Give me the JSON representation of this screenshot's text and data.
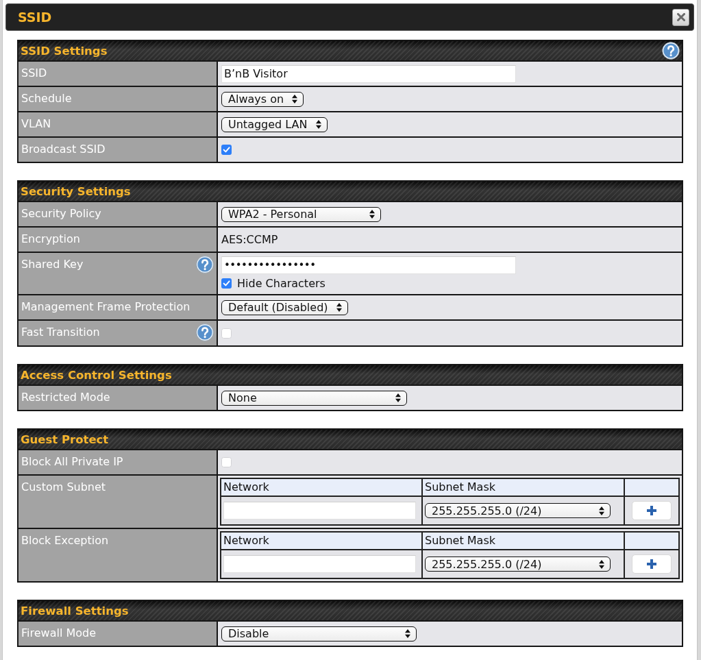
{
  "dialog": {
    "title": "SSID"
  },
  "sections": [
    {
      "title": "SSID Settings",
      "help": true,
      "rows": [
        {
          "kind": "text",
          "label": "SSID",
          "value": "B’nB Visitor"
        },
        {
          "kind": "select",
          "label": "Schedule",
          "value": "Always on"
        },
        {
          "kind": "select",
          "label": "VLAN",
          "value": "Untagged LAN"
        },
        {
          "kind": "checkbox",
          "label": "Broadcast SSID",
          "checked": true
        }
      ]
    },
    {
      "title": "Security Settings",
      "rows": [
        {
          "kind": "select",
          "label": "Security Policy",
          "value": "WPA2 - Personal"
        },
        {
          "kind": "static",
          "label": "Encryption",
          "value": "AES:CCMP"
        },
        {
          "kind": "password",
          "label": "Shared Key",
          "help": true,
          "value": "••••••••••••••••",
          "option": {
            "label": "Hide Characters",
            "checked": true
          }
        },
        {
          "kind": "select",
          "label": "Management Frame Protection",
          "value": "Default (Disabled)"
        },
        {
          "kind": "checkbox",
          "label": "Fast Transition",
          "help": true,
          "checked": false
        }
      ]
    },
    {
      "title": "Access Control Settings",
      "rows": [
        {
          "kind": "select",
          "label": "Restricted Mode",
          "value": "None"
        }
      ]
    },
    {
      "title": "Guest Protect",
      "rows": [
        {
          "kind": "checkbox",
          "label": "Block All Private IP",
          "checked": false
        },
        {
          "kind": "subnet",
          "label": "Custom Subnet",
          "columns": [
            "Network",
            "Subnet Mask"
          ],
          "mask": "255.255.255.0 (/24)"
        },
        {
          "kind": "subnet",
          "label": "Block Exception",
          "columns": [
            "Network",
            "Subnet Mask"
          ],
          "mask": "255.255.255.0 (/24)"
        }
      ]
    },
    {
      "title": "Firewall Settings",
      "rows": [
        {
          "kind": "select",
          "label": "Firewall Mode",
          "value": "Disable"
        }
      ]
    }
  ]
}
